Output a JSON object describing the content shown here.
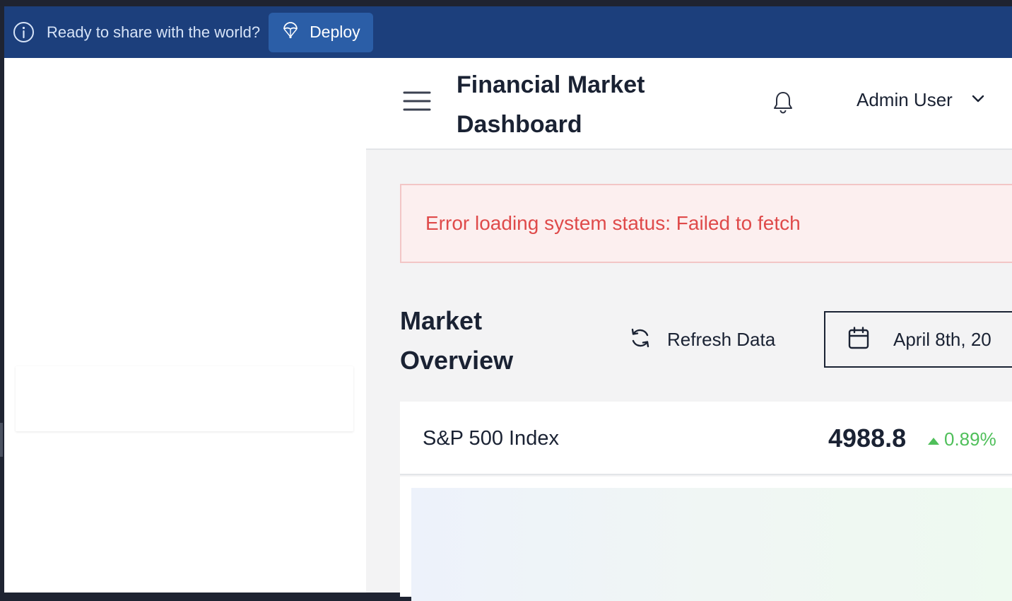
{
  "banner": {
    "icon": "info-icon",
    "message": "Ready to share with the world?",
    "deploy_icon": "parachute-icon",
    "deploy_label": "Deploy"
  },
  "header": {
    "menu_icon": "hamburger-menu-icon",
    "title": "Financial Market Dashboard",
    "bell_icon": "bell-icon",
    "user_name": "Admin User",
    "user_chevron": "chevron-down-icon"
  },
  "alert": {
    "message": "Error loading system status: Failed to fetch",
    "color": "#df4a4a"
  },
  "overview": {
    "title": "Market Overview",
    "refresh_icon": "refresh-icon",
    "refresh_label": "Refresh Data",
    "calendar_icon": "calendar-icon",
    "date_label": "April 8th, 20"
  },
  "index_card": {
    "name": "S&P 500 Index",
    "value": "4988.8",
    "change": "0.89%",
    "trend_icon": "caret-up-icon",
    "change_color": "#4fbf5a"
  },
  "colors": {
    "banner_bg": "#1c3f7c",
    "deploy_btn_bg": "#2b5ea7",
    "text_primary": "#1a2233"
  }
}
